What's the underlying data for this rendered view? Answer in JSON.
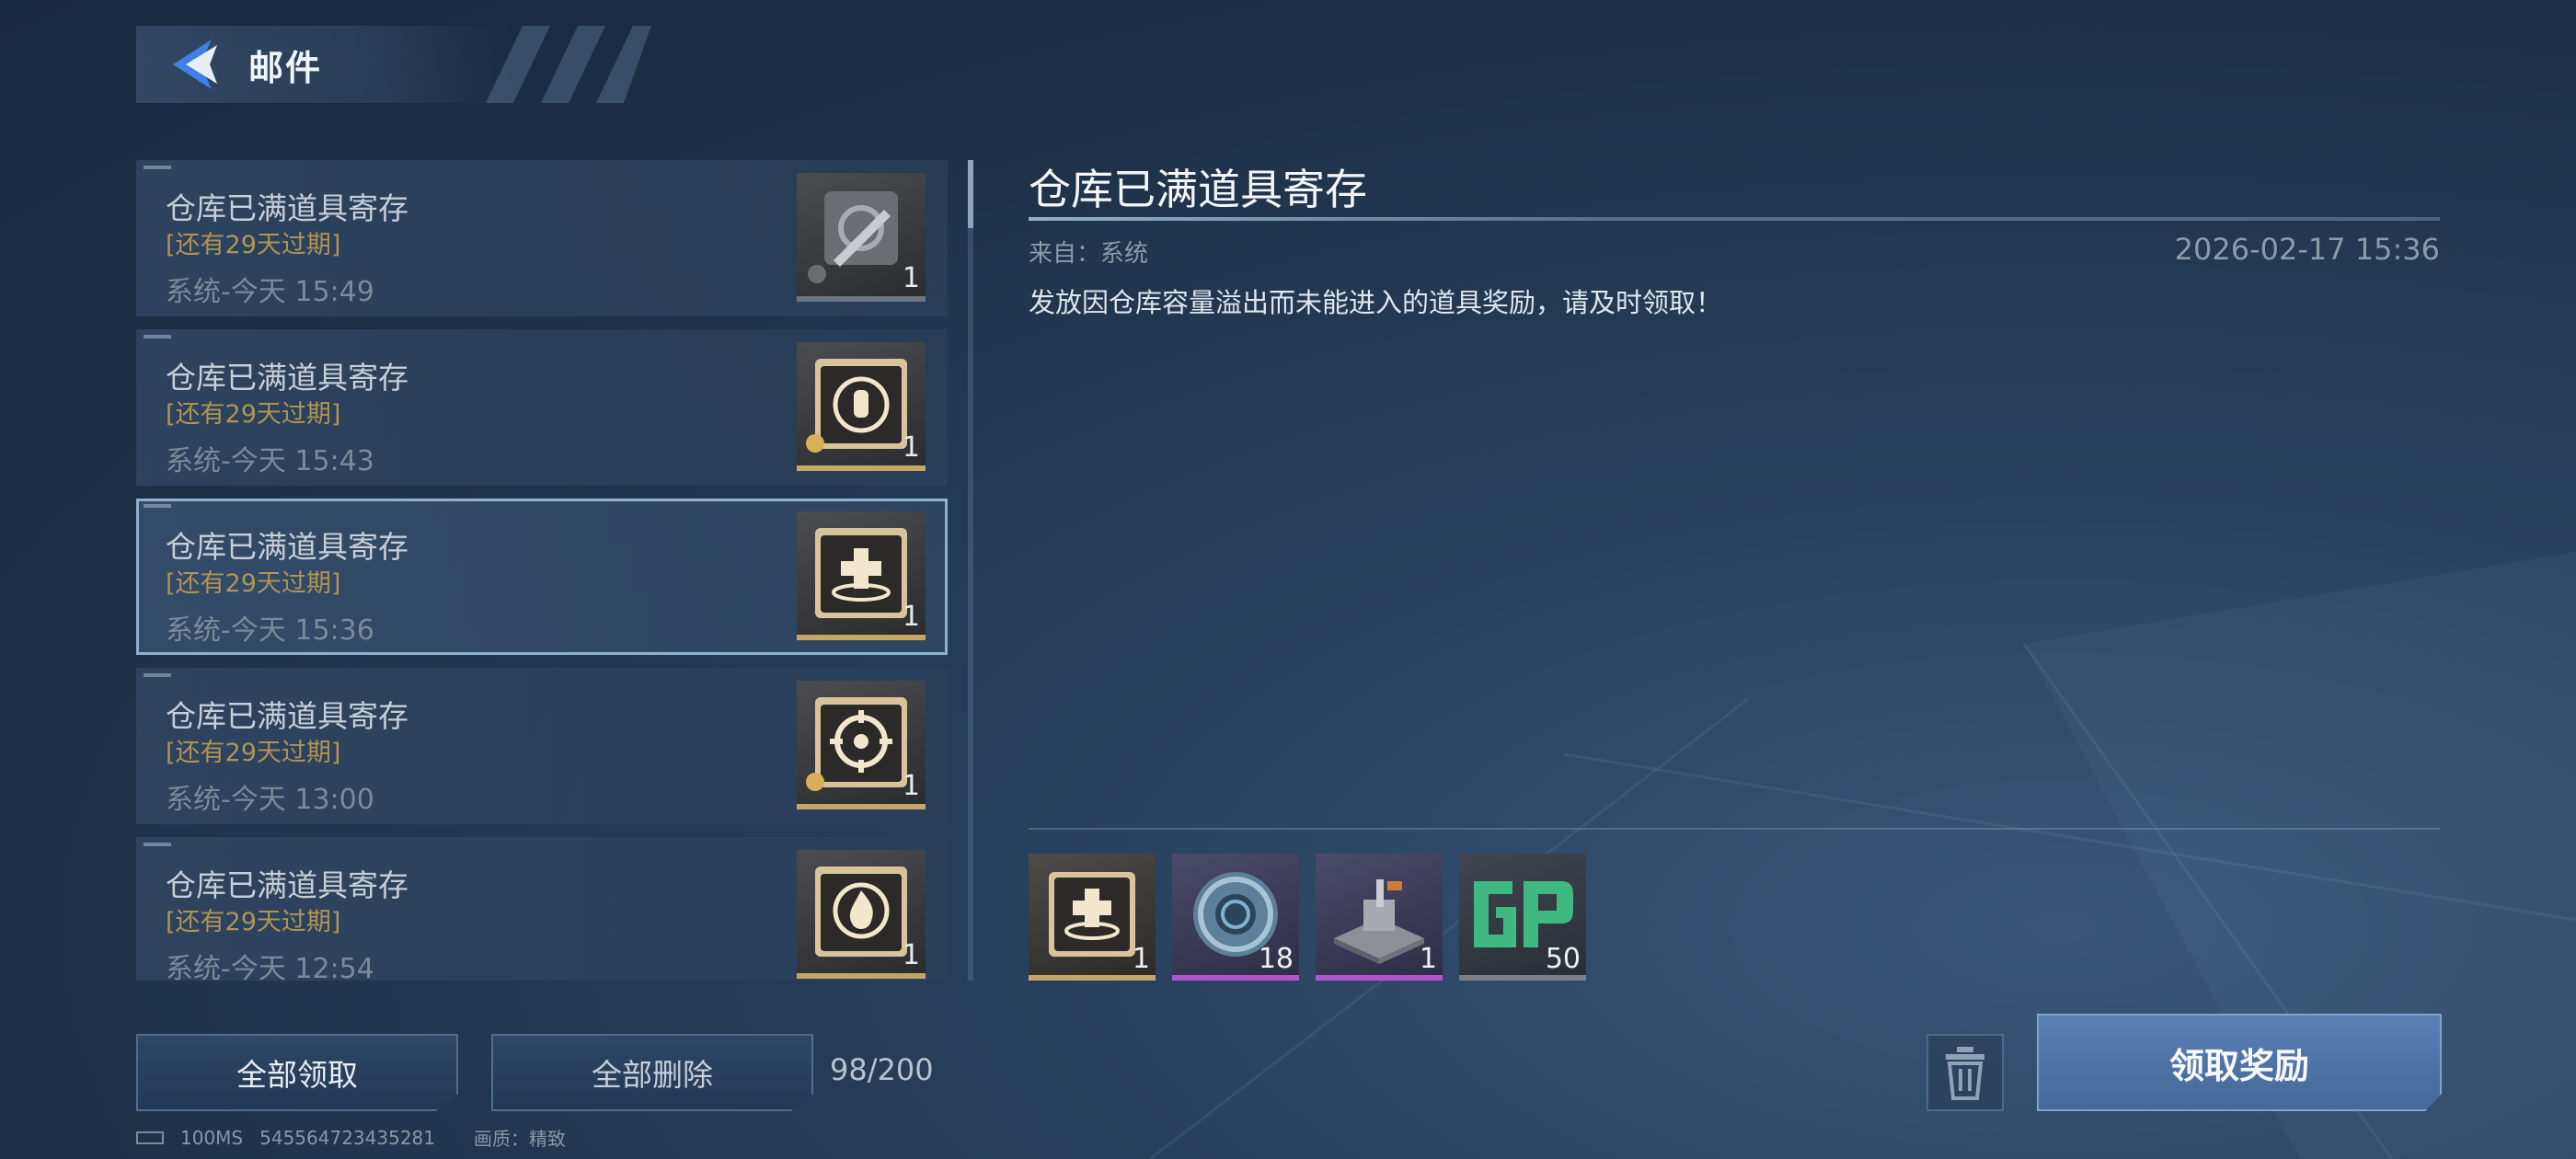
{
  "header": {
    "title": "邮件"
  },
  "mails": [
    {
      "title": "仓库已满道具寄存",
      "expire": "[还有29天过期]",
      "time": "系统-今天 15:49",
      "qty": "1",
      "icon": "wrench-gear-icon",
      "selected": false
    },
    {
      "title": "仓库已满道具寄存",
      "expire": "[还有29天过期]",
      "time": "系统-今天 15:43",
      "qty": "1",
      "icon": "hand-cycle-icon",
      "selected": false
    },
    {
      "title": "仓库已满道具寄存",
      "expire": "[还有29天过期]",
      "time": "系统-今天 15:36",
      "qty": "1",
      "icon": "medical-cross-icon",
      "selected": true
    },
    {
      "title": "仓库已满道具寄存",
      "expire": "[还有29天过期]",
      "time": "系统-今天 13:00",
      "qty": "1",
      "icon": "crosshair-icon",
      "selected": false
    },
    {
      "title": "仓库已满道具寄存",
      "expire": "[还有29天过期]",
      "time": "系统-今天 12:54",
      "qty": "1",
      "icon": "flame-icon",
      "selected": false
    }
  ],
  "actions": {
    "claim_all": "全部领取",
    "delete_all": "全部删除",
    "count": "98/200"
  },
  "footer": {
    "latency": "100MS",
    "uid": "545564723435281",
    "quality": "画质：精致"
  },
  "detail": {
    "title": "仓库已满道具寄存",
    "from": "来自：系统",
    "date": "2026-02-17 15:36",
    "body": "发放因仓库容量溢出而未能进入的道具奖励，请及时领取！",
    "attachments": [
      {
        "icon": "medical-cross-icon",
        "qty": "1",
        "rarity": "gold"
      },
      {
        "icon": "shield-disc-icon",
        "qty": "18",
        "rarity": "purple"
      },
      {
        "icon": "turret-icon",
        "qty": "1",
        "rarity": "purple"
      },
      {
        "icon": "gp-currency-icon",
        "qty": "50",
        "rarity": "grey"
      }
    ],
    "claim_label": "领取奖励"
  },
  "colors": {
    "accent_gold": "#c4a766",
    "accent_purple": "#b054c8",
    "button_blue": "#5a7fb2"
  }
}
